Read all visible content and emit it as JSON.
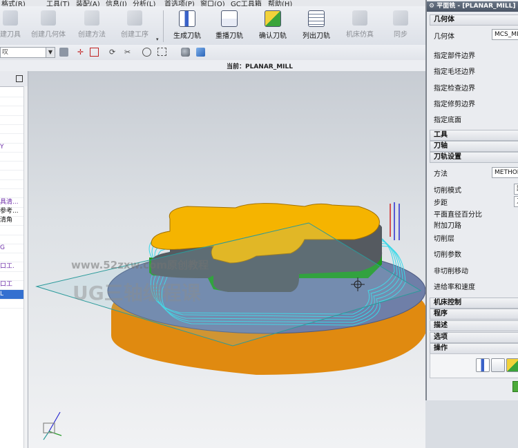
{
  "menubar": {
    "items": [
      "格式(R)",
      "工具(T)",
      "装配(A)",
      "信息(I)",
      "分析(L)",
      "首选项(P)",
      "窗口(O)",
      "GC工具箱",
      "帮助(H)"
    ]
  },
  "toolbar": {
    "buttons": [
      {
        "label": "建刀具",
        "enabled": false
      },
      {
        "label": "创建几何体",
        "enabled": false
      },
      {
        "label": "创建方法",
        "enabled": false
      },
      {
        "label": "创建工序",
        "enabled": false
      },
      {
        "label": "生成刀轨",
        "enabled": true
      },
      {
        "label": "重播刀轨",
        "enabled": true
      },
      {
        "label": "确认刀轨",
        "enabled": true
      },
      {
        "label": "列出刀轨",
        "enabled": true
      },
      {
        "label": "机床仿真",
        "enabled": false
      },
      {
        "label": "同步",
        "enabled": false
      }
    ]
  },
  "filter": {
    "value": "叹"
  },
  "status": {
    "text": "当前：PLANAR_MILL"
  },
  "navigator": {
    "rows": [
      {
        "text": "",
        "style": ""
      },
      {
        "text": "",
        "style": ""
      },
      {
        "text": "",
        "style": ""
      },
      {
        "text": "",
        "style": ""
      },
      {
        "text": "",
        "style": ""
      },
      {
        "text": "",
        "style": ""
      },
      {
        "text": "Y",
        "style": "purple"
      },
      {
        "text": "",
        "style": ""
      },
      {
        "text": "",
        "style": ""
      },
      {
        "text": "",
        "style": ""
      },
      {
        "text": "",
        "style": ""
      },
      {
        "text": "",
        "style": ""
      },
      {
        "text": "具清...",
        "style": "purple"
      },
      {
        "text": "参考...",
        "style": ""
      },
      {
        "text": "清角",
        "style": ""
      },
      {
        "text": "",
        "style": ""
      },
      {
        "text": "",
        "style": ""
      },
      {
        "text": "G",
        "style": "purple"
      },
      {
        "text": "",
        "style": ""
      },
      {
        "text": "口工.",
        "style": "purple"
      },
      {
        "text": "",
        "style": ""
      },
      {
        "text": "口工",
        "style": "purple"
      },
      {
        "text": "L",
        "style": "sel"
      },
      {
        "text": "",
        "style": ""
      }
    ]
  },
  "watermark": {
    "line1": "www.52zxw.com原创教程",
    "line2": "UG三轴编程课"
  },
  "dialog": {
    "title": "平面铣 - [PLANAR_MILL]",
    "sections": {
      "geometry": "几何体",
      "tool": "工具",
      "axis": "刀轴",
      "path": "刀轨设置",
      "machine": "机床控制",
      "program": "程序",
      "desc": "描述",
      "options": "选项",
      "operation": "操作"
    },
    "geometry_rows": [
      "几何体",
      "指定部件边界",
      "指定毛坯边界",
      "指定检查边界",
      "指定修剪边界",
      "指定底面"
    ],
    "geometry_value": "MCS_MILL",
    "path_rows": [
      "方法",
      "切削模式",
      "步距",
      "平面直径百分比",
      "附加刀路",
      "切削层",
      "切削参数",
      "非切削移动",
      "进给率和速度"
    ],
    "method_value": "METHOD",
    "cut_mode_value": "跟",
    "step_value": "刀"
  },
  "colors": {
    "part_top": "#f5b400",
    "part_wall": "#555a60",
    "green_band": "#1f9a1f",
    "toolpath": "#38d8e8",
    "base_top": "#6f7fa8",
    "base_side": "#e08a10",
    "selected": "#3470d0"
  }
}
